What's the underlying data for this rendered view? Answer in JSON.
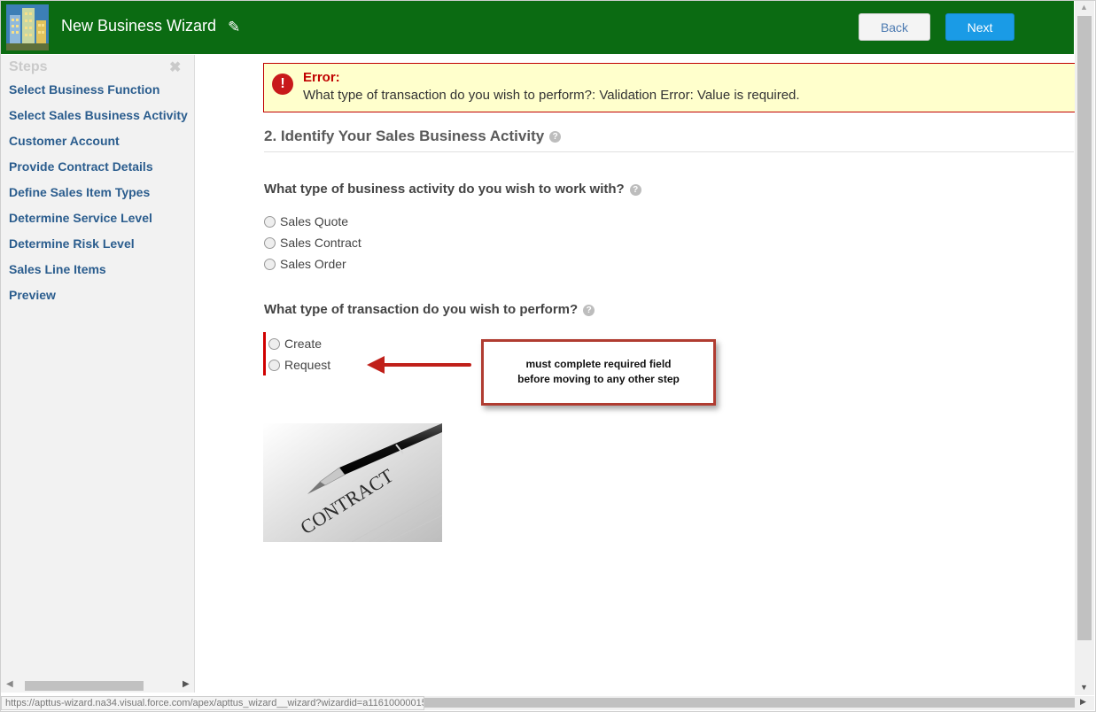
{
  "header": {
    "title": "New Business Wizard",
    "back_label": "Back",
    "next_label": "Next",
    "background": "#0b6b12"
  },
  "sidebar": {
    "title": "Steps",
    "close_glyph": "✖",
    "items": [
      {
        "label": "Select Business Function"
      },
      {
        "label": "Select Sales Business Activity"
      },
      {
        "label": "Customer Account"
      },
      {
        "label": "Provide Contract Details"
      },
      {
        "label": "Define Sales Item Types"
      },
      {
        "label": "Determine Service Level"
      },
      {
        "label": "Determine Risk Level"
      },
      {
        "label": "Sales Line Items"
      },
      {
        "label": "Preview"
      }
    ]
  },
  "error": {
    "title": "Error:",
    "message": "What type of transaction do you wish to perform?: Validation Error: Value is required.",
    "icon_glyph": "!"
  },
  "section": {
    "title": "2. Identify Your Sales Business Activity"
  },
  "question1": {
    "label": "What type of business activity do you wish to work with?",
    "options": [
      "Sales Quote",
      "Sales Contract",
      "Sales Order"
    ]
  },
  "question2": {
    "label": "What type of transaction do you wish to perform?",
    "options": [
      "Create",
      "Request"
    ]
  },
  "callout": {
    "line1": "must complete required field",
    "line2": "before moving to any other step"
  },
  "image": {
    "caption": "CONTRACT"
  },
  "status": {
    "url": "https://apttus-wizard.na34.visual.force.com/apex/apttus_wizard__wizard?wizardid=a11610000015tAqAAI#"
  },
  "icons": {
    "logo": "building-logo-icon",
    "edit": "pencil-icon",
    "help": "help-circle-icon",
    "error": "error-icon"
  }
}
